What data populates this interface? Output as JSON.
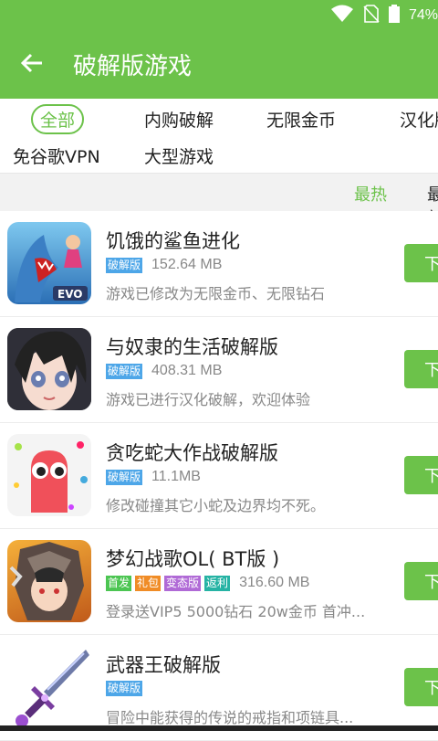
{
  "status": {
    "battery": "74%"
  },
  "appbar": {
    "title": "破解版游戏"
  },
  "filters": [
    {
      "label": "全部",
      "active": true
    },
    {
      "label": "内购破解"
    },
    {
      "label": "无限金币"
    },
    {
      "label": "汉化版"
    },
    {
      "label": "免谷歌VPN"
    },
    {
      "label": "大型游戏"
    }
  ],
  "sort": {
    "hot": "最热",
    "new": "最新"
  },
  "colors": {
    "accent": "#6cc24a",
    "badge_blue": "#4da6e8",
    "badge_green": "#4cc552",
    "badge_orange": "#f08c26",
    "badge_purple": "#b06ad6",
    "badge_teal": "#26b3a4"
  },
  "games": [
    {
      "name": "饥饿的鲨鱼进化",
      "badges": [
        {
          "text": "破解版",
          "color": "#4da6e8"
        }
      ],
      "size": "152.64 MB",
      "desc": "游戏已修改为无限金币、无限钻石",
      "button": "下载",
      "icon": "shark-icon"
    },
    {
      "name": "与奴隶的生活破解版",
      "badges": [
        {
          "text": "破解版",
          "color": "#4da6e8"
        }
      ],
      "size": "408.31 MB",
      "desc": "游戏已进行汉化破解，欢迎体验",
      "button": "下载",
      "icon": "anime-girl-icon"
    },
    {
      "name": "贪吃蛇大作战破解版",
      "badges": [
        {
          "text": "破解版",
          "color": "#4da6e8"
        }
      ],
      "size": "11.1MB",
      "desc": "修改碰撞其它小蛇及边界均不死。",
      "button": "下载",
      "icon": "snake-icon"
    },
    {
      "name": "梦幻战歌OL( BT版 )",
      "badges": [
        {
          "text": "首发",
          "color": "#4cc552"
        },
        {
          "text": "礼包",
          "color": "#f08c26"
        },
        {
          "text": "变态版",
          "color": "#b06ad6"
        },
        {
          "text": "返利",
          "color": "#26b3a4"
        }
      ],
      "size": "316.60 MB",
      "desc": "登录送VIP5 5000钻石 20w金币 首冲...",
      "button": "下载",
      "icon": "warrior-icon"
    },
    {
      "name": "武器王破解版",
      "badges": [
        {
          "text": "破解版",
          "color": "#4da6e8"
        }
      ],
      "size": "",
      "desc": "冒险中能获得的传说的戒指和项链具...",
      "button": "下载",
      "icon": "sword-icon"
    }
  ]
}
